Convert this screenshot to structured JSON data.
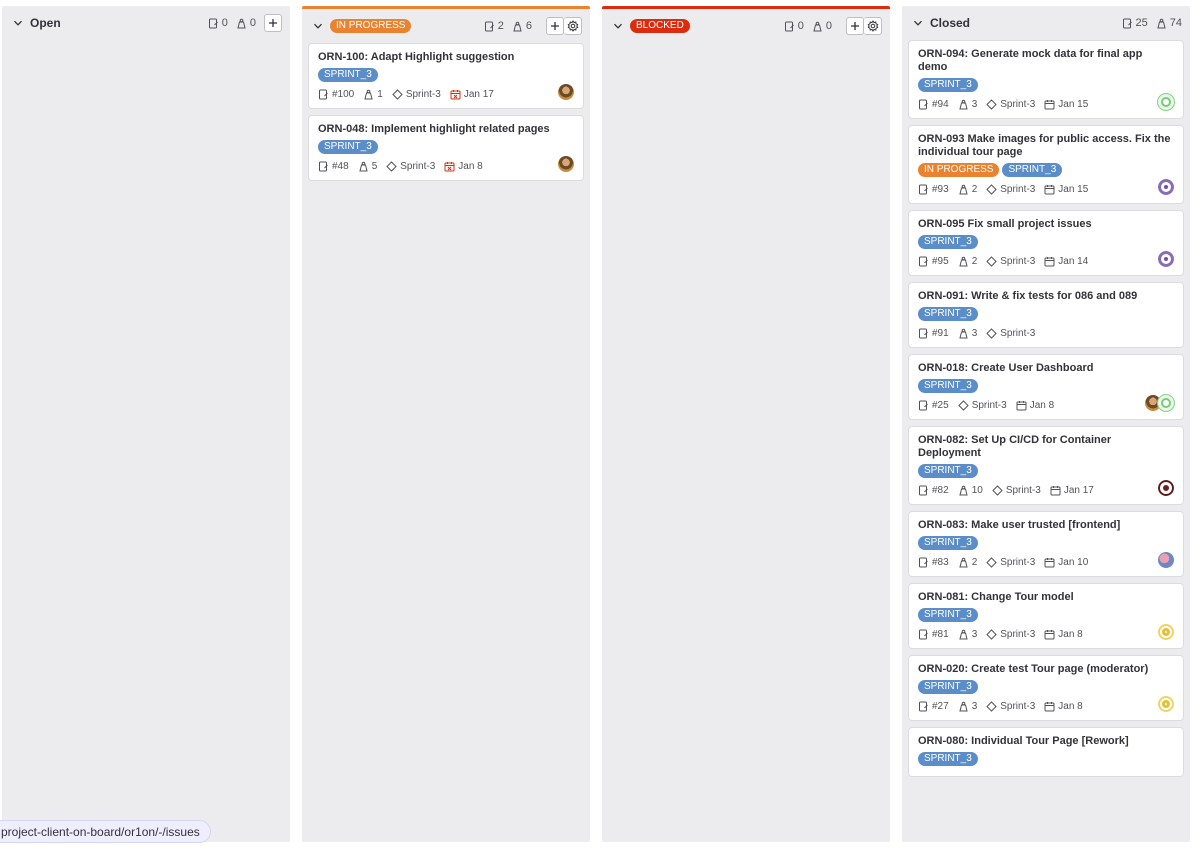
{
  "board": {
    "lists": [
      {
        "id": "open",
        "title": "Open",
        "title_style": "text",
        "issue_count": "0",
        "weight": "0",
        "cards": []
      },
      {
        "id": "progress",
        "title": "IN PROGRESS",
        "title_style": "pill",
        "issue_count": "2",
        "weight": "6",
        "cards": [
          {
            "title": "ORN-100: Adapt Highlight suggestion",
            "labels": [
              "SPRINT_3"
            ],
            "iid": "#100",
            "weight": "1",
            "milestone": "Sprint-3",
            "due": "Jan 17",
            "due_overdue": true,
            "avatars": [
              "photo"
            ]
          },
          {
            "title": "ORN-048: Implement highlight related pages",
            "labels": [
              "SPRINT_3"
            ],
            "iid": "#48",
            "weight": "5",
            "milestone": "Sprint-3",
            "due": "Jan 8",
            "due_overdue": true,
            "avatars": [
              "photo"
            ]
          }
        ]
      },
      {
        "id": "blocked",
        "title": "BLOCKED",
        "title_style": "pill",
        "issue_count": "0",
        "weight": "0",
        "cards": []
      },
      {
        "id": "closed",
        "title": "Closed",
        "title_style": "text",
        "issue_count": "25",
        "weight": "74",
        "cards": [
          {
            "title": "ORN-094: Generate mock data for final app demo",
            "labels": [
              "SPRINT_3"
            ],
            "iid": "#94",
            "weight": "3",
            "milestone": "Sprint-3",
            "due": "Jan 15",
            "avatars": [
              "green"
            ]
          },
          {
            "title": "ORN-093 Make images for public access. Fix the individual tour page",
            "labels": [
              "IN PROGRESS",
              "SPRINT_3"
            ],
            "iid": "#93",
            "weight": "2",
            "milestone": "Sprint-3",
            "due": "Jan 15",
            "avatars": [
              "purple"
            ]
          },
          {
            "title": "ORN-095 Fix small project issues",
            "labels": [
              "SPRINT_3"
            ],
            "iid": "#95",
            "weight": "2",
            "milestone": "Sprint-3",
            "due": "Jan 14",
            "avatars": [
              "purple"
            ]
          },
          {
            "title": "ORN-091: Write & fix tests for 086 and 089",
            "labels": [
              "SPRINT_3"
            ],
            "iid": "#91",
            "weight": "3",
            "milestone": "Sprint-3",
            "due": "",
            "avatars": []
          },
          {
            "title": "ORN-018: Create User Dashboard",
            "labels": [
              "SPRINT_3"
            ],
            "iid": "#25",
            "weight": "",
            "milestone": "Sprint-3",
            "due": "Jan 8",
            "avatars": [
              "photo",
              "green"
            ]
          },
          {
            "title": "ORN-082: Set Up CI/CD for Container Deployment",
            "labels": [
              "SPRINT_3"
            ],
            "iid": "#82",
            "weight": "10",
            "milestone": "Sprint-3",
            "due": "Jan 17",
            "avatars": [
              "darkred"
            ]
          },
          {
            "title": "ORN-083: Make user trusted [frontend]",
            "labels": [
              "SPRINT_3"
            ],
            "iid": "#83",
            "weight": "2",
            "milestone": "Sprint-3",
            "due": "Jan 10",
            "avatars": [
              "pinkblue"
            ]
          },
          {
            "title": "ORN-081: Change Tour model",
            "labels": [
              "SPRINT_3"
            ],
            "iid": "#81",
            "weight": "3",
            "milestone": "Sprint-3",
            "due": "Jan 8",
            "avatars": [
              "yellow"
            ]
          },
          {
            "title": "ORN-020: Create test Tour page (moderator)",
            "labels": [
              "SPRINT_3"
            ],
            "iid": "#27",
            "weight": "3",
            "milestone": "Sprint-3",
            "due": "Jan 8",
            "avatars": [
              "yellow"
            ]
          },
          {
            "title": "ORN-080: Individual Tour Page [Rework]",
            "labels": [
              "SPRINT_3"
            ],
            "iid": "",
            "weight": "",
            "milestone": "",
            "due": "",
            "avatars": []
          }
        ]
      }
    ]
  },
  "status_bar": {
    "url": "project-client-on-board/or1on/-/issues"
  },
  "colors": {
    "in_progress": "#e9832f",
    "blocked": "#dd2b0e",
    "sprint_label": "#5b8dc9",
    "list_bg": "#ececef"
  }
}
